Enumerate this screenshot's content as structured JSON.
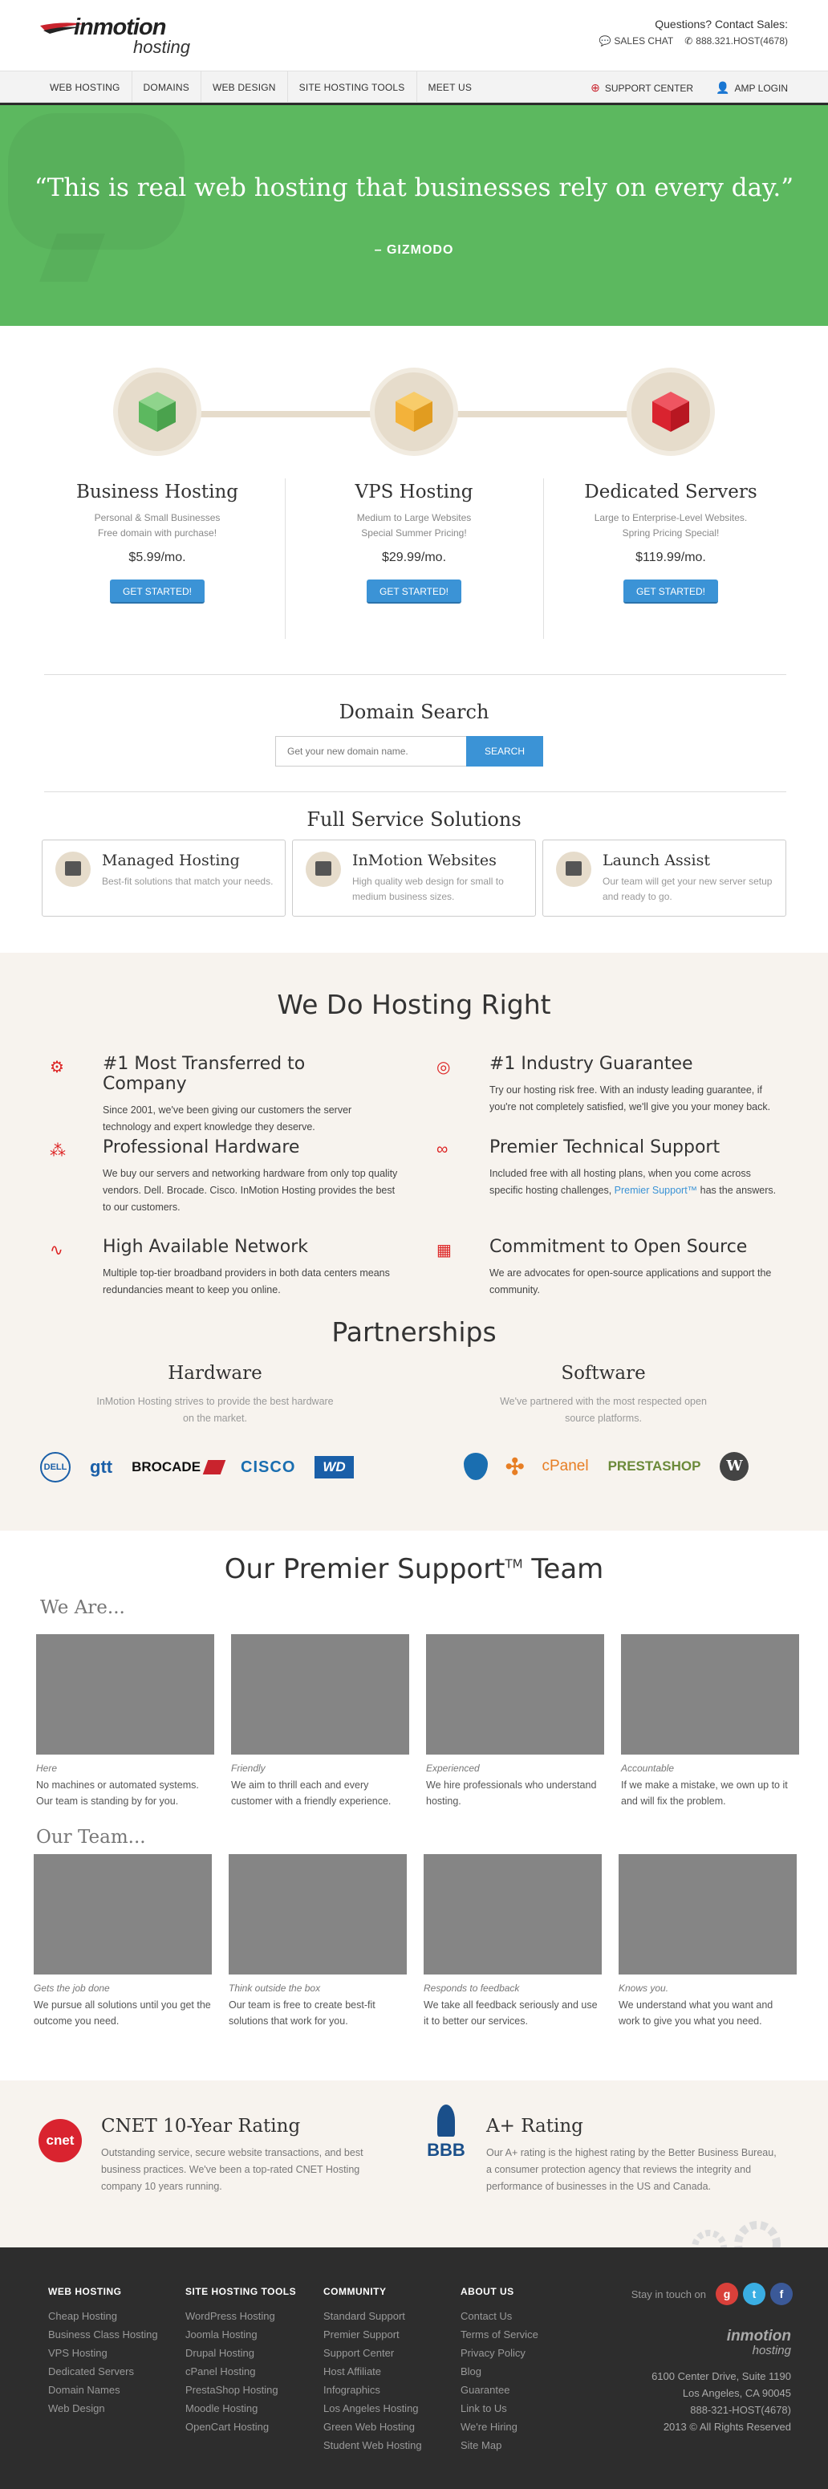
{
  "header": {
    "logo_main": "inmotion",
    "logo_sub": "hosting",
    "contact_label": "Questions? Contact Sales:",
    "sales_chat": "SALES CHAT",
    "phone": "888.321.HOST(4678)"
  },
  "nav": {
    "items": [
      "WEB HOSTING",
      "DOMAINS",
      "WEB DESIGN",
      "SITE HOSTING TOOLS",
      "MEET US"
    ],
    "support_center": "SUPPORT CENTER",
    "amp_login": "AMP LOGIN"
  },
  "hero": {
    "quote": "“This is real web hosting that businesses rely on every day.”",
    "source": "– GIZMODO"
  },
  "plans": [
    {
      "title": "Business Hosting",
      "desc1": "Personal & Small Businesses",
      "desc2": "Free domain with purchase!",
      "price": "$5.99/mo.",
      "button": "GET STARTED!",
      "color": "#6cc06b"
    },
    {
      "title": "VPS Hosting",
      "desc1": "Medium to Large Websites",
      "desc2": "Special Summer Pricing!",
      "price": "$29.99/mo.",
      "button": "GET STARTED!",
      "color": "#f3b23a"
    },
    {
      "title": "Dedicated Servers",
      "desc1": "Large to Enterprise-Level Websites.",
      "desc2": "Spring Pricing Special!",
      "price": "$119.99/mo.",
      "button": "GET STARTED!",
      "color": "#d9232f"
    }
  ],
  "domain": {
    "title": "Domain Search",
    "placeholder": "Get your new domain name.",
    "button": "SEARCH"
  },
  "services": {
    "title": "Full Service Solutions",
    "cards": [
      {
        "title": "Managed Hosting",
        "text": "Best-fit solutions that match your needs."
      },
      {
        "title": "InMotion Websites",
        "text": "High quality web design for small to medium business sizes."
      },
      {
        "title": "Launch Assist",
        "text": "Our team will get your new server setup and ready to go."
      }
    ]
  },
  "right": {
    "title": "We Do Hosting Right",
    "features": [
      {
        "title": "#1 Most Transferred to Company",
        "text": "Since 2001, we've been giving our customers the server technology and expert knowledge they deserve.",
        "icon": "gears-icon",
        "glyph": "⚙"
      },
      {
        "title": "#1 Industry Guarantee",
        "text": "Try our hosting risk free. With an industy leading guarantee, if you're not completely satisfied, we'll give you your money back.",
        "icon": "globe-icon",
        "glyph": "◎"
      },
      {
        "title": "Professional Hardware",
        "text": "We buy our servers and networking hardware from only top quality vendors. Dell. Brocade. Cisco. InMotion Hosting provides the best to our customers.",
        "icon": "network-icon",
        "glyph": "⁂"
      },
      {
        "title": "Premier Technical Support",
        "text_before": "Included free with all hosting plans, when you come across specific hosting challenges, ",
        "link": "Premier Support™",
        "text_after": " has the answers.",
        "icon": "link-icon",
        "glyph": "∞"
      },
      {
        "title": "High Available Network",
        "text": "Multiple top-tier broadband providers in both data centers means redundancies meant to keep you online.",
        "icon": "chart-icon",
        "glyph": "∿"
      },
      {
        "title": "Commitment to Open Source",
        "text": "We are advocates for open-source applications and support the community.",
        "icon": "blocks-icon",
        "glyph": "▦"
      }
    ]
  },
  "partnerships": {
    "title": "Partnerships",
    "hardware_title": "Hardware",
    "hardware_desc": "InMotion Hosting strives to provide the best hardware on the market.",
    "software_title": "Software",
    "software_desc": "We've partnered with the most respected open source platforms.",
    "hardware_logos": [
      "DELL",
      "gtt",
      "BROCADE",
      "CISCO",
      "WD"
    ],
    "software_logos": [
      "drupal",
      "joomla",
      "cPanel",
      "PRESTASHOP",
      "W"
    ]
  },
  "team": {
    "title": "Our Premier Support",
    "title_tm": "TM",
    "title_end": " Team",
    "we_are": "We Are...",
    "our_team": "Our Team...",
    "we_are_items": [
      {
        "cap": "Here",
        "text": "No machines or automated systems. Our team is standing by for you."
      },
      {
        "cap": "Friendly",
        "text": "We aim to thrill each and every customer with a friendly experience."
      },
      {
        "cap": "Experienced",
        "text": "We hire professionals who understand hosting."
      },
      {
        "cap": "Accountable",
        "text": "If we make a mistake, we own up to it and will fix the problem."
      }
    ],
    "our_team_items": [
      {
        "cap": "Gets the job done",
        "text": "We pursue all solutions until you get the outcome you need."
      },
      {
        "cap": "Think outside the box",
        "text": "Our team is free to create best-fit solutions that work for you."
      },
      {
        "cap": "Responds to feedback",
        "text": "We take all feedback seriously and use it to better our services."
      },
      {
        "cap": "Knows you.",
        "text": "We understand what you want and work to give you what you need."
      }
    ]
  },
  "ratings": [
    {
      "badge": "cnet",
      "title": "CNET 10-Year Rating",
      "text": "Outstanding service, secure website transactions, and best business practices. We've been a top-rated CNET Hosting company 10 years running."
    },
    {
      "badge": "BBB",
      "title": "A+ Rating",
      "text": "Our A+ rating is the highest rating by the Better Business Bureau, a consumer protection agency that reviews the integrity and performance of businesses in the US and Canada."
    }
  ],
  "footer": {
    "columns": [
      {
        "title": "WEB HOSTING",
        "items": [
          "Cheap Hosting",
          "Business Class Hosting",
          "VPS Hosting",
          "Dedicated Servers",
          "Domain Names",
          "Web Design"
        ]
      },
      {
        "title": "SITE HOSTING TOOLS",
        "items": [
          "WordPress Hosting",
          "Joomla Hosting",
          "Drupal Hosting",
          "cPanel Hosting",
          "PrestaShop Hosting",
          "Moodle Hosting",
          "OpenCart Hosting"
        ]
      },
      {
        "title": "COMMUNITY",
        "items": [
          "Standard Support",
          "Premier Support",
          "Support Center",
          "Host Affiliate",
          "Infographics",
          "Los Angeles Hosting",
          "Green Web Hosting",
          "Student Web Hosting"
        ]
      },
      {
        "title": "ABOUT US",
        "items": [
          "Contact Us",
          "Terms of Service",
          "Privacy Policy",
          "Blog",
          "Guarantee",
          "Link to Us",
          "We're Hiring",
          "Site Map"
        ]
      }
    ],
    "stay": "Stay in touch on",
    "social": [
      "g",
      "t",
      "f"
    ],
    "logo_main": "inmotion",
    "logo_sub": "hosting",
    "address1": "6100 Center Drive, Suite 1190",
    "address2": "Los Angeles, CA 90045",
    "phone": "888-321-HOST(4678)",
    "copyright": "2013 © All Rights Reserved"
  }
}
